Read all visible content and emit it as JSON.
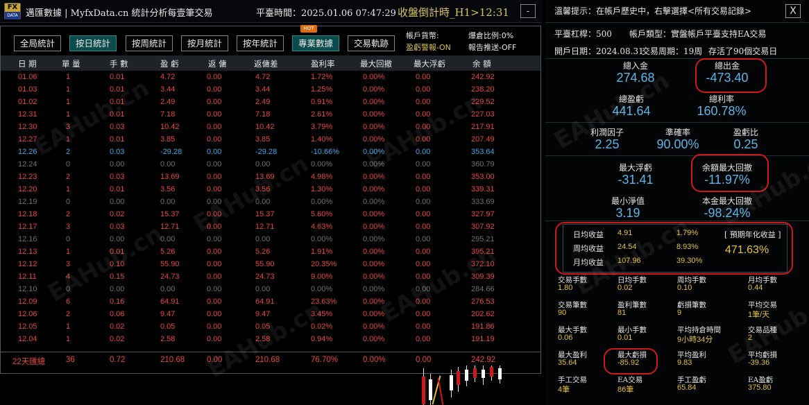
{
  "header": {
    "app_title": "邁匯數據 | MyfxData.cn 統計分析每壹筆交易",
    "server_time": "平臺時間：2025.01.06 07:47:29",
    "countdown": "收盤倒計時_H1>12:31",
    "minimize_label": "-",
    "logo_top": "FX",
    "logo_bottom": "DATA"
  },
  "tabs": [
    {
      "label": "全局統計",
      "active": false
    },
    {
      "label": "按日統計",
      "active": true
    },
    {
      "label": "按周統計",
      "active": false
    },
    {
      "label": "按月統計",
      "active": false
    },
    {
      "label": "按年統計",
      "active": false
    },
    {
      "label": "專業數據",
      "active": false
    },
    {
      "label": "交易軌跡",
      "active": false
    }
  ],
  "hot_badge": "HOT",
  "account_info": {
    "currency": "帳戶貨幣:",
    "margin_ratio": "爆倉比例:0%",
    "profit_alert": "盈虧警報-ON",
    "report_push": "報告推送-OFF"
  },
  "table": {
    "columns": [
      "日 期",
      "單 量",
      "手 數",
      "盈 虧",
      "返 傭",
      "返傭差",
      "盈利率",
      "最大回撤",
      "最大浮虧",
      "余 額"
    ],
    "rows": [
      {
        "type": "pos",
        "cells": [
          "01.06",
          "1",
          "0.01",
          "4.72",
          "0.00",
          "4.72",
          "1.72%",
          "0.00%",
          "0.00",
          "242.92"
        ]
      },
      {
        "type": "pos",
        "cells": [
          "01.03",
          "1",
          "0.01",
          "3.44",
          "0.00",
          "3.44",
          "1.25%",
          "0.00%",
          "0.00",
          "238.20"
        ]
      },
      {
        "type": "pos",
        "cells": [
          "01.02",
          "1",
          "0.01",
          "2.49",
          "0.00",
          "2.49",
          "0.91%",
          "0.00%",
          "0.00",
          "229.52"
        ]
      },
      {
        "type": "pos",
        "cells": [
          "12.31",
          "1",
          "0.01",
          "7.18",
          "0.00",
          "7.18",
          "2.61%",
          "0.00%",
          "0.00",
          "227.03"
        ]
      },
      {
        "type": "pos",
        "cells": [
          "12.30",
          "3",
          "0.03",
          "10.42",
          "0.00",
          "10.42",
          "3.79%",
          "0.00%",
          "0.00",
          "217.91"
        ]
      },
      {
        "type": "pos",
        "cells": [
          "12.27",
          "1",
          "0.01",
          "3.85",
          "0.00",
          "3.85",
          "1.40%",
          "0.00%",
          "0.00",
          "207.49"
        ]
      },
      {
        "type": "neg",
        "cells": [
          "12.26",
          "2",
          "0.03",
          "-29.28",
          "0.00",
          "-29.28",
          "-10.66%",
          "0.00%",
          "0.00",
          "353.64"
        ]
      },
      {
        "type": "zero",
        "cells": [
          "12.24",
          "0",
          "0.00",
          "0.00",
          "0.00",
          "0.00",
          "0.00%",
          "0.00%",
          "0.00",
          "360.79"
        ]
      },
      {
        "type": "pos",
        "cells": [
          "12.23",
          "2",
          "0.03",
          "13.69",
          "0.00",
          "13.69",
          "4.98%",
          "0.00%",
          "0.00",
          "353.00"
        ]
      },
      {
        "type": "pos",
        "cells": [
          "12.20",
          "1",
          "0.01",
          "3.56",
          "0.00",
          "3.56",
          "1.30%",
          "0.00%",
          "0.00",
          "339.31"
        ]
      },
      {
        "type": "zero",
        "cells": [
          "12.19",
          "0",
          "0.00",
          "0.00",
          "0.00",
          "0.00",
          "0.00%",
          "0.00%",
          "0.00",
          "333.69"
        ]
      },
      {
        "type": "pos",
        "cells": [
          "12.18",
          "2",
          "0.02",
          "15.37",
          "0.00",
          "15.37",
          "5.60%",
          "0.00%",
          "0.00",
          "327.97"
        ]
      },
      {
        "type": "pos",
        "cells": [
          "12.17",
          "3",
          "0.03",
          "12.71",
          "0.00",
          "12.71",
          "4.63%",
          "0.00%",
          "0.00",
          "307.92"
        ]
      },
      {
        "type": "zero",
        "cells": [
          "12.16",
          "0",
          "0.00",
          "0.00",
          "0.00",
          "0.00",
          "0.00%",
          "0.00%",
          "0.00",
          "295.21"
        ]
      },
      {
        "type": "pos",
        "cells": [
          "12.13",
          "1",
          "0.01",
          "5.26",
          "0.00",
          "5.26",
          "1.91%",
          "0.00%",
          "0.00",
          "395.21"
        ]
      },
      {
        "type": "pos",
        "cells": [
          "12.12",
          "3",
          "0.10",
          "55.90",
          "0.00",
          "55.90",
          "20.35%",
          "0.00%",
          "0.00",
          "372.10"
        ]
      },
      {
        "type": "pos",
        "cells": [
          "12.11",
          "4",
          "0.15",
          "24.73",
          "0.00",
          "24.73",
          "9.00%",
          "0.00%",
          "0.00",
          "309.39"
        ]
      },
      {
        "type": "zero",
        "cells": [
          "12.10",
          "0",
          "0.00",
          "0.00",
          "0.00",
          "0.00",
          "0.00%",
          "0.00%",
          "0.00",
          "284.66"
        ]
      },
      {
        "type": "pos",
        "cells": [
          "12.09",
          "6",
          "0.16",
          "64.91",
          "0.00",
          "64.91",
          "23.63%",
          "0.00%",
          "0.00",
          "276.53"
        ]
      },
      {
        "type": "pos",
        "cells": [
          "12.06",
          "2",
          "0.06",
          "9.47",
          "0.00",
          "9.47",
          "3.45%",
          "0.00%",
          "0.00",
          "202.62"
        ]
      },
      {
        "type": "pos",
        "cells": [
          "12.05",
          "1",
          "0.02",
          "0.05",
          "0.00",
          "0.05",
          "0.02%",
          "0.00%",
          "0.00",
          "191.86"
        ]
      },
      {
        "type": "pos",
        "cells": [
          "12.04",
          "1",
          "0.02",
          "2.58",
          "0.00",
          "2.58",
          "0.94%",
          "0.00%",
          "0.00",
          "191.19"
        ]
      }
    ],
    "summary": [
      "22天匯總",
      "36",
      "0.72",
      "210.68",
      "0.00",
      "210.68",
      "76.70%",
      "0.00%",
      "0.00",
      "242.92"
    ]
  },
  "right": {
    "hint": "溫馨提示：在帳戶歷史中，右擊選擇<所有交易記錄>",
    "close": "X",
    "platform_leverage": "平臺杠桿：500",
    "account_type": "帳戶類型：實盤帳戶",
    "ea_support": "平臺支持EA交易",
    "open_date": "開戶日期：2024.08.31",
    "trade_cycle": "交易周期：19周",
    "survived": "存活了90個交易日",
    "stats": {
      "deposit_label": "總入金",
      "deposit": "274.68",
      "withdraw_label": "總出金",
      "withdraw": "-473.40",
      "total_pl_label": "總盈虧",
      "total_pl": "441.64",
      "total_rate_label": "總利率",
      "total_rate": "160.78%",
      "pf_label": "利潤因子",
      "pf": "2.25",
      "accuracy_label": "準確率",
      "accuracy": "90.00%",
      "plratio_label": "盈虧比",
      "plratio": "0.25",
      "maxfloat_label": "最大浮虧",
      "maxfloat": "-31.41",
      "maxdd_label": "余額最大回撤",
      "maxdd": "-11.97%",
      "minnet_label": "最小淨值",
      "minnet": "3.19",
      "capdd_label": "本金最大回撤",
      "capdd": "-98.24%"
    },
    "profit_box": {
      "daily_label": "日均收益",
      "daily": "4.91",
      "daily_pct": "1.79%",
      "weekly_label": "周均收益",
      "weekly": "24.54",
      "weekly_pct": "8.93%",
      "monthly_label": "月均收益",
      "monthly": "107.96",
      "monthly_pct": "39.30%",
      "annual_label": "[ 預期年化收益 ]",
      "annual": "471.63%"
    },
    "grid": [
      {
        "label": "交易手數",
        "value": "1.80"
      },
      {
        "label": "日均手數",
        "value": "0.02"
      },
      {
        "label": "周均手數",
        "value": "0.10"
      },
      {
        "label": "月均手數",
        "value": "0.44"
      },
      {
        "label": "交易筆數",
        "value": "90"
      },
      {
        "label": "盈利筆數",
        "value": "81"
      },
      {
        "label": "虧損筆數",
        "value": "9"
      },
      {
        "label": "平均交易",
        "value": "1筆/天"
      },
      {
        "label": "最大手數",
        "value": "0.06"
      },
      {
        "label": "最小手數",
        "value": "0.01"
      },
      {
        "label": "平均持倉時間",
        "value": "9小時34分"
      },
      {
        "label": "交易品種",
        "value": "2"
      },
      {
        "label": "最大盈利",
        "value": "35.64"
      },
      {
        "label": "最大虧損",
        "value": "-85.92"
      },
      {
        "label": "平均盈利",
        "value": "9.83"
      },
      {
        "label": "平均虧損",
        "value": "-39.36"
      },
      {
        "label": "手工交易",
        "value": "4筆"
      },
      {
        "label": "EA交易",
        "value": "86筆"
      },
      {
        "label": "手工盈虧",
        "value": "65.84"
      },
      {
        "label": "EA盈虧",
        "value": "375.80"
      }
    ]
  },
  "watermark": "EAHub.cn",
  "colors": {
    "profit": "#e8463f",
    "loss": "#3fa8e8",
    "zero": "#707070",
    "stat_value": "#5ab8e8",
    "highlight": "#e8c23a",
    "accent_tab": "#0c4b4b"
  }
}
